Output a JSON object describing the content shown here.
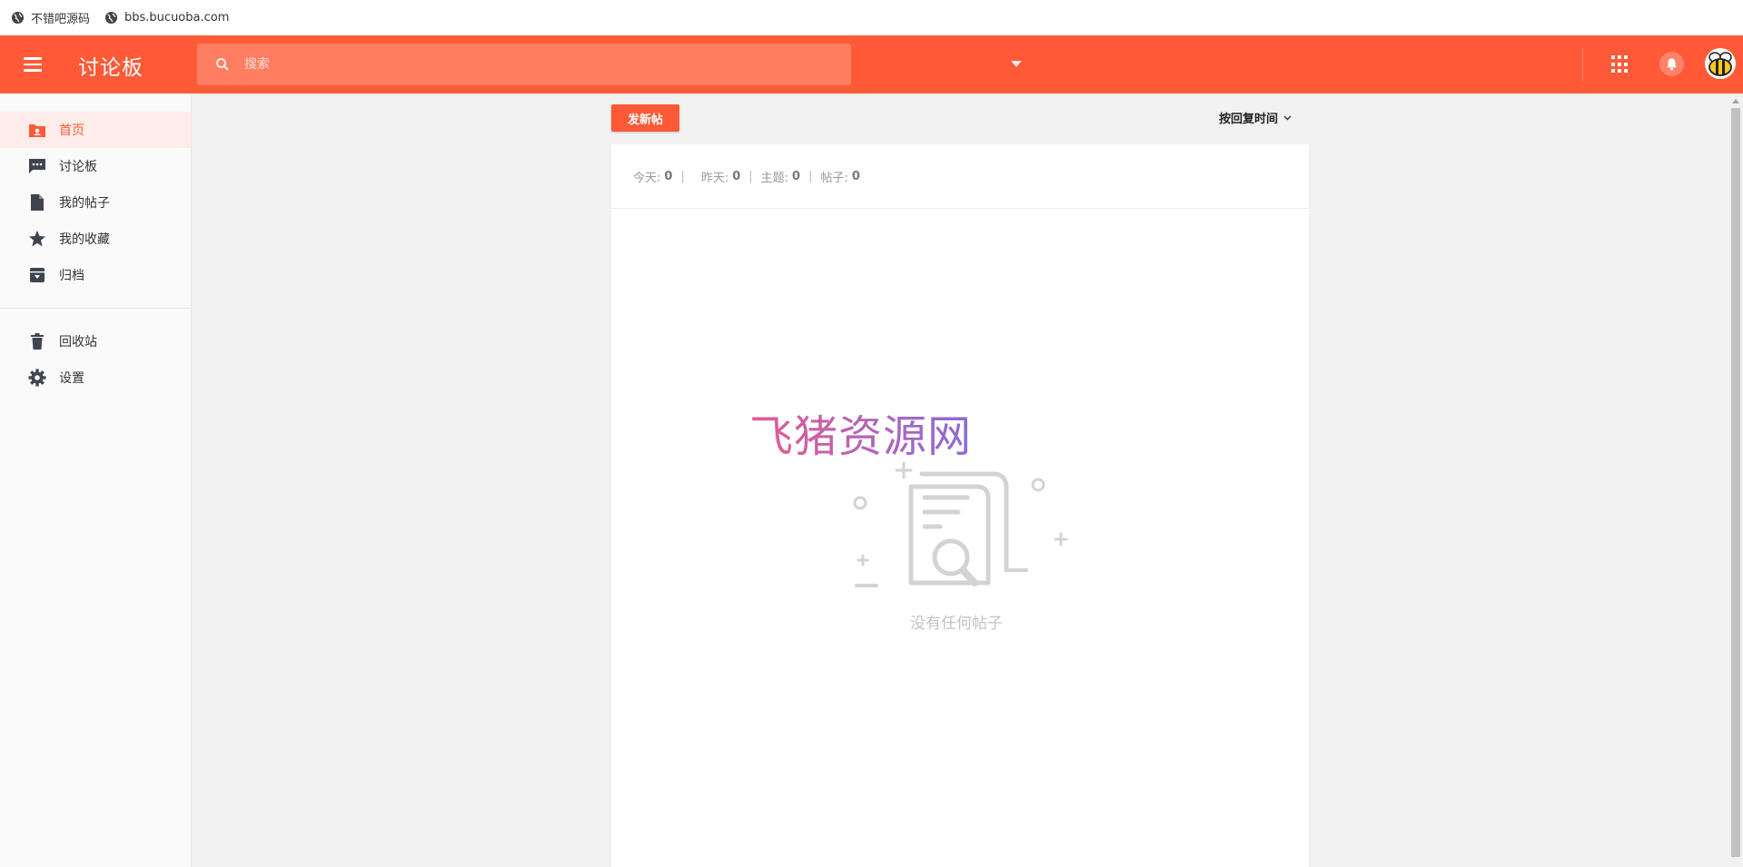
{
  "bookmarks": [
    {
      "label": "不错吧源码",
      "icon": "globe-icon"
    },
    {
      "label": "bbs.bucuoba.com",
      "icon": "globe-icon"
    }
  ],
  "appbar": {
    "title": "讨论板",
    "search_placeholder": "搜索",
    "accent_color": "#ff5a37"
  },
  "sidebar": {
    "items": [
      {
        "label": "首页",
        "icon": "home-folder-icon",
        "active": true
      },
      {
        "label": "讨论板",
        "icon": "forum-icon"
      },
      {
        "label": "我的帖子",
        "icon": "document-icon"
      },
      {
        "label": "我的收藏",
        "icon": "star-icon"
      },
      {
        "label": "归档",
        "icon": "archive-icon"
      }
    ],
    "secondary": [
      {
        "label": "回收站",
        "icon": "trash-icon"
      },
      {
        "label": "设置",
        "icon": "gear-icon"
      }
    ]
  },
  "main": {
    "new_post_label": "发新帖",
    "sort_label": "按回复时间",
    "stats": [
      {
        "label": "今天:",
        "value": "0"
      },
      {
        "label": "昨天:",
        "value": "0"
      },
      {
        "label": "主题:",
        "value": "0"
      },
      {
        "label": "帖子:",
        "value": "0"
      }
    ],
    "watermark": "飞猪资源网",
    "empty_text": "没有任何帖子"
  }
}
